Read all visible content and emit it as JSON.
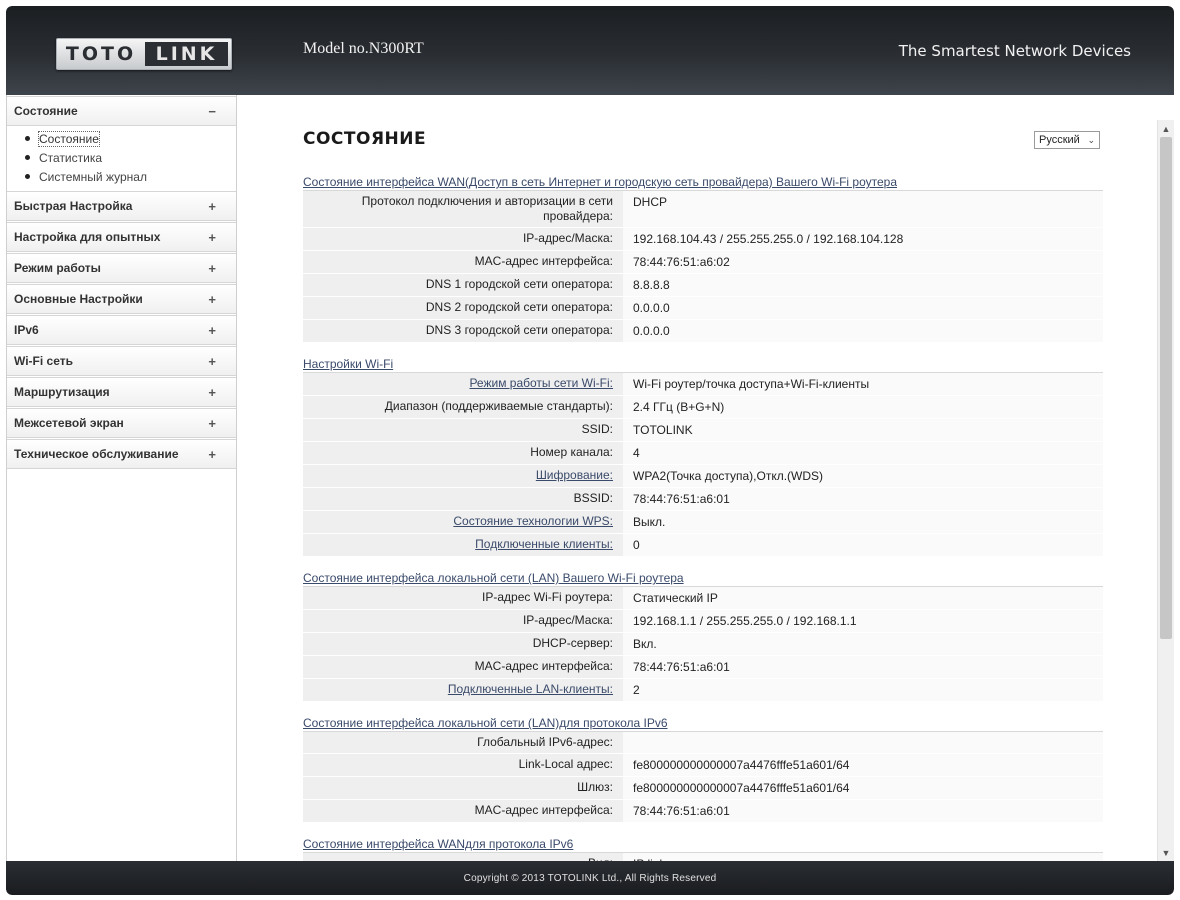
{
  "header": {
    "logo_left": "TOTO",
    "logo_right": "LINK",
    "model": "Model no.N300RT",
    "slogan": "The Smartest Network Devices"
  },
  "sidebar": {
    "groups": [
      {
        "label": "Состояние",
        "sign": "−",
        "items": [
          "Состояние",
          "Статистика",
          "Системный журнал"
        ]
      },
      {
        "label": "Быстрая Настройка",
        "sign": "+"
      },
      {
        "label": "Настройка для опытных",
        "sign": "+"
      },
      {
        "label": "Режим работы",
        "sign": "+"
      },
      {
        "label": "Основные Настройки",
        "sign": "+"
      },
      {
        "label": "IPv6",
        "sign": "+"
      },
      {
        "label": "Wi-Fi сеть",
        "sign": "+"
      },
      {
        "label": "Маршрутизация",
        "sign": "+"
      },
      {
        "label": "Межсетевой экран",
        "sign": "+"
      },
      {
        "label": "Техническое обслуживание",
        "sign": "+"
      }
    ]
  },
  "main": {
    "title": "СОСТОЯНИЕ",
    "language": "Русский",
    "sections": [
      {
        "title": "Состояние интерфейса WAN(Доступ в сеть Интернет и городскую сеть провайдера) Вашего Wi-Fi роутера",
        "rows": [
          {
            "label": "Протокол подключения и авторизации в сети провайдера:",
            "value": "DHCP",
            "link": false
          },
          {
            "label": "IP-адрес/Маска:",
            "value": "192.168.104.43 / 255.255.255.0 / 192.168.104.128",
            "link": false
          },
          {
            "label": "MAC-адрес интерфейса:",
            "value": "78:44:76:51:a6:02",
            "link": false
          },
          {
            "label": "DNS 1 городской сети оператора:",
            "value": "8.8.8.8",
            "link": false
          },
          {
            "label": "DNS 2 городской сети оператора:",
            "value": "0.0.0.0",
            "link": false
          },
          {
            "label": "DNS 3 городской сети оператора:",
            "value": "0.0.0.0",
            "link": false
          }
        ]
      },
      {
        "title": "Настройки Wi-Fi",
        "rows": [
          {
            "label": "Режим работы сети Wi-Fi:",
            "value": "Wi-Fi роутер/точка доступа+Wi-Fi-клиенты",
            "link": true
          },
          {
            "label": "Диапазон (поддерживаемые стандарты):",
            "value": "2.4 ГГц (B+G+N)",
            "link": false
          },
          {
            "label": "SSID:",
            "value": "TOTOLINK",
            "link": false
          },
          {
            "label": "Номер канала:",
            "value": "4",
            "link": false
          },
          {
            "label": "Шифрование:",
            "value": "WPA2(Точка доступа),Откл.(WDS)",
            "link": true
          },
          {
            "label": "BSSID:",
            "value": "78:44:76:51:a6:01",
            "link": false
          },
          {
            "label": "Состояние технологии WPS:",
            "value": "Выкл.",
            "link": true
          },
          {
            "label": "Подключенные клиенты:",
            "value": "0",
            "link": true
          }
        ]
      },
      {
        "title": "Состояние интерфейса локальной сети (LAN) Вашего Wi-Fi роутера",
        "rows": [
          {
            "label": "IP-адрес Wi-Fi роутера:",
            "value": "Статический IP",
            "link": false
          },
          {
            "label": "IP-адрес/Маска:",
            "value": "192.168.1.1 / 255.255.255.0 / 192.168.1.1",
            "link": false
          },
          {
            "label": "DHCP-сервер:",
            "value": "Вкл.",
            "link": false
          },
          {
            "label": "MAC-адрес интерфейса:",
            "value": "78:44:76:51:a6:01",
            "link": false
          },
          {
            "label": "Подключенные LAN-клиенты:",
            "value": "2",
            "link": true
          }
        ]
      },
      {
        "title": "Состояние интерфейса локальной сети (LAN)для протокола IPv6",
        "rows": [
          {
            "label": "Глобальный IPv6-адрес:",
            "value": "",
            "link": false
          },
          {
            "label": "Link-Local адрес:",
            "value": "fe800000000000007a4476fffe51a601/64",
            "link": false
          },
          {
            "label": "Шлюз:",
            "value": "fe800000000000007a4476fffe51a601/64",
            "link": false
          },
          {
            "label": "MAC-адрес интерфейса:",
            "value": "78:44:76:51:a6:01",
            "link": false
          }
        ]
      },
      {
        "title": "Состояние интерфейса WANдля протокола IPv6",
        "rows": [
          {
            "label": "Вид:",
            "value": "IP link",
            "link": false
          },
          {
            "label": "",
            "value": "",
            "link": false
          }
        ]
      }
    ]
  },
  "footer": {
    "copyright": "Copyright © 2013 TOTOLINK Ltd.,   All Rights Reserved"
  }
}
